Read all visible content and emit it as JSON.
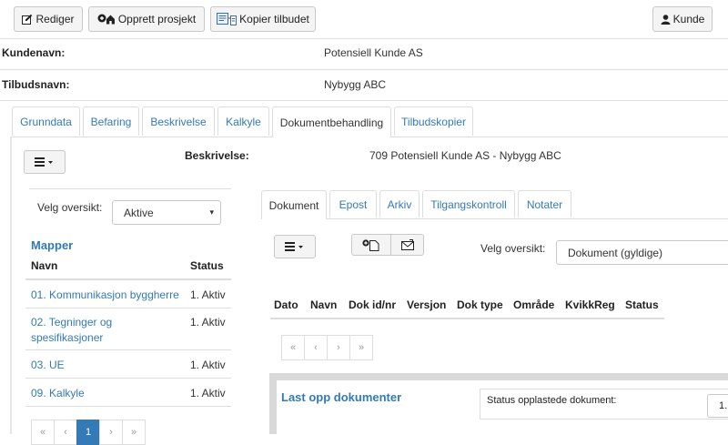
{
  "toolbar": {
    "edit_label": "Rediger",
    "create_project_label": "Opprett prosjekt",
    "copy_offer_label": "Kopier tilbudet",
    "customer_label": "Kunde"
  },
  "info": {
    "customer_name_label": "Kundenavn:",
    "customer_name_value": "Potensiell Kunde AS",
    "offer_name_label": "Tilbudsnavn:",
    "offer_name_value": "Nybygg ABC"
  },
  "main_tabs": [
    {
      "label": "Grunndata"
    },
    {
      "label": "Befaring"
    },
    {
      "label": "Beskrivelse"
    },
    {
      "label": "Kalkyle"
    },
    {
      "label": "Dokumentbehandling"
    },
    {
      "label": "Tilbudskopier"
    }
  ],
  "description": {
    "label": "Beskrivelse:",
    "value": "709 Potensiell Kunde AS - Nybygg ABC"
  },
  "left_panel": {
    "view_label": "Velg oversikt:",
    "view_value": "Aktive",
    "folders_title": "Mapper",
    "col_name": "Navn",
    "col_status": "Status",
    "folders": [
      {
        "name": "01. Kommunikasjon byggherre",
        "status": "1. Aktiv"
      },
      {
        "name": "02. Tegninger og spesifikasjoner",
        "status": "1. Aktiv"
      },
      {
        "name": "03. UE",
        "status": "1. Aktiv"
      },
      {
        "name": "09. Kalkyle",
        "status": "1. Aktiv"
      }
    ],
    "pagination": {
      "first": "«",
      "prev": "‹",
      "current": "1",
      "next": "›",
      "last": "»"
    }
  },
  "doc_tabs": [
    {
      "label": "Dokument"
    },
    {
      "label": "Epost"
    },
    {
      "label": "Arkiv"
    },
    {
      "label": "Tilgangskontroll"
    },
    {
      "label": "Notater"
    }
  ],
  "doc_panel": {
    "view_label": "Velg oversikt:",
    "view_value": "Dokument (gyldige)",
    "columns": [
      "Dato",
      "Navn",
      "Dok id/nr",
      "Versjon",
      "Dok type",
      "Område",
      "KvikkReg",
      "Status"
    ],
    "pagination": {
      "first": "«",
      "prev": "‹",
      "next": "›",
      "last": "»"
    }
  },
  "upload": {
    "title": "Last opp dokumenter",
    "status_label": "Status opplastede dokument:",
    "status_value": "1."
  },
  "icons": {
    "edit": "pencil-square-icon",
    "create_project": "plus-house-icon",
    "copy": "copy-document-icon",
    "user": "user-icon",
    "menu": "hamburger-menu-icon",
    "new_doc": "new-document-icon",
    "email": "envelope-icon"
  },
  "colors": {
    "link": "#337ab7",
    "page_active": "#337ab7"
  }
}
